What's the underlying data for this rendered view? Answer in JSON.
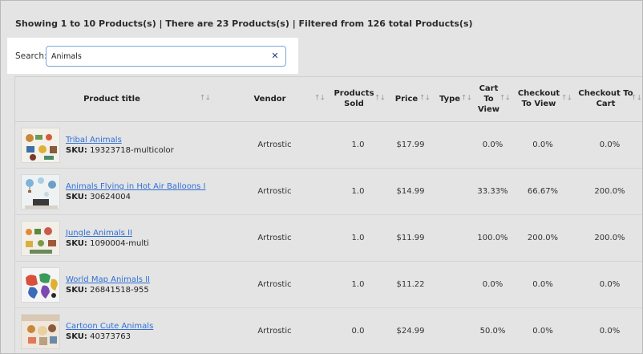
{
  "summary": "Showing 1 to 10 Products(s) | There are 23 Products(s) | Filtered from 126 total Products(s)",
  "search": {
    "label": "Search:",
    "value": "Animals",
    "clear_icon": "close-icon"
  },
  "columns": [
    {
      "key": "title",
      "label": "Product title"
    },
    {
      "key": "vendor",
      "label": "Vendor"
    },
    {
      "key": "sold",
      "label": "Products Sold"
    },
    {
      "key": "price",
      "label": "Price"
    },
    {
      "key": "type",
      "label": "Type"
    },
    {
      "key": "ctv",
      "label": "Cart To View"
    },
    {
      "key": "chtv",
      "label": "Checkout To View"
    },
    {
      "key": "chtc",
      "label": "Checkout To Cart"
    }
  ],
  "sort_icon": "sort-arrows-icon",
  "sku_label": "SKU:",
  "rows": [
    {
      "title": "Tribal Animals",
      "sku": "19323718-multicolor",
      "vendor": "Artrostic",
      "sold": "1.0",
      "price": "$17.99",
      "type": "",
      "ctv": "0.0%",
      "chtv": "0.0%",
      "chtc": "0.0%"
    },
    {
      "title": "Animals Flying in Hot Air Balloons I",
      "sku": "30624004",
      "vendor": "Artrostic",
      "sold": "1.0",
      "price": "$14.99",
      "type": "",
      "ctv": "33.33%",
      "chtv": "66.67%",
      "chtc": "200.0%"
    },
    {
      "title": "Jungle Animals II",
      "sku": "1090004-multi",
      "vendor": "Artrostic",
      "sold": "1.0",
      "price": "$11.99",
      "type": "",
      "ctv": "100.0%",
      "chtv": "200.0%",
      "chtc": "200.0%"
    },
    {
      "title": "World Map Animals II",
      "sku": "26841518-955",
      "vendor": "Artrostic",
      "sold": "1.0",
      "price": "$11.22",
      "type": "",
      "ctv": "0.0%",
      "chtv": "0.0%",
      "chtc": "0.0%"
    },
    {
      "title": "Cartoon Cute Animals",
      "sku": "40373763",
      "vendor": "Artrostic",
      "sold": "0.0",
      "price": "$24.99",
      "type": "",
      "ctv": "50.0%",
      "chtv": "0.0%",
      "chtc": "0.0%"
    }
  ]
}
